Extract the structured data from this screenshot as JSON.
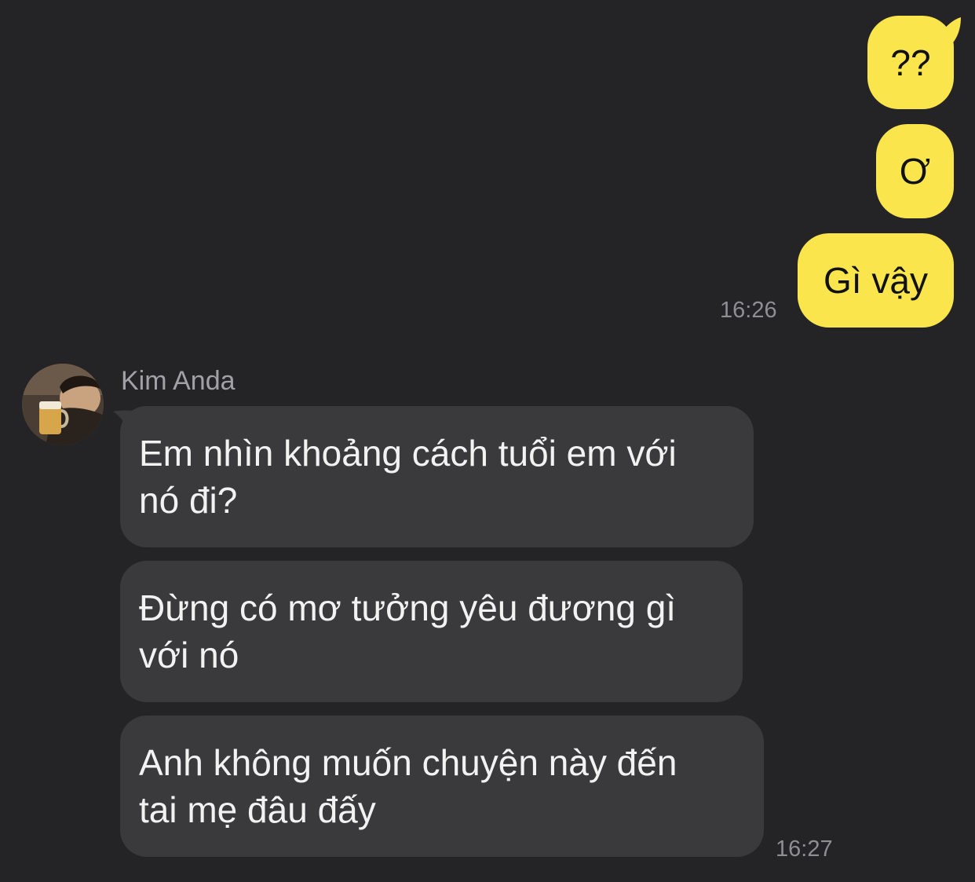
{
  "colors": {
    "background": "#242426",
    "sent_bubble": "#FAE64C",
    "received_bubble": "#3A3A3C",
    "timestamp": "#8E8E93"
  },
  "messages_sent": [
    {
      "text": "??"
    },
    {
      "text": "Ơ"
    },
    {
      "text": "Gì vậy"
    }
  ],
  "sent_time": "16:26",
  "contact": {
    "name": "Kim Anda",
    "avatar_icon": "profile-photo"
  },
  "messages_received": [
    {
      "line1": "Em nhìn khoảng cách tuổi em với",
      "line2": "nó đi?"
    },
    {
      "line1": "Đừng có mơ tưởng yêu đương gì",
      "line2": "với nó"
    },
    {
      "line1": "Anh không muốn chuyện này đến",
      "line2": "tai mẹ đâu đấy"
    }
  ],
  "received_time": "16:27"
}
